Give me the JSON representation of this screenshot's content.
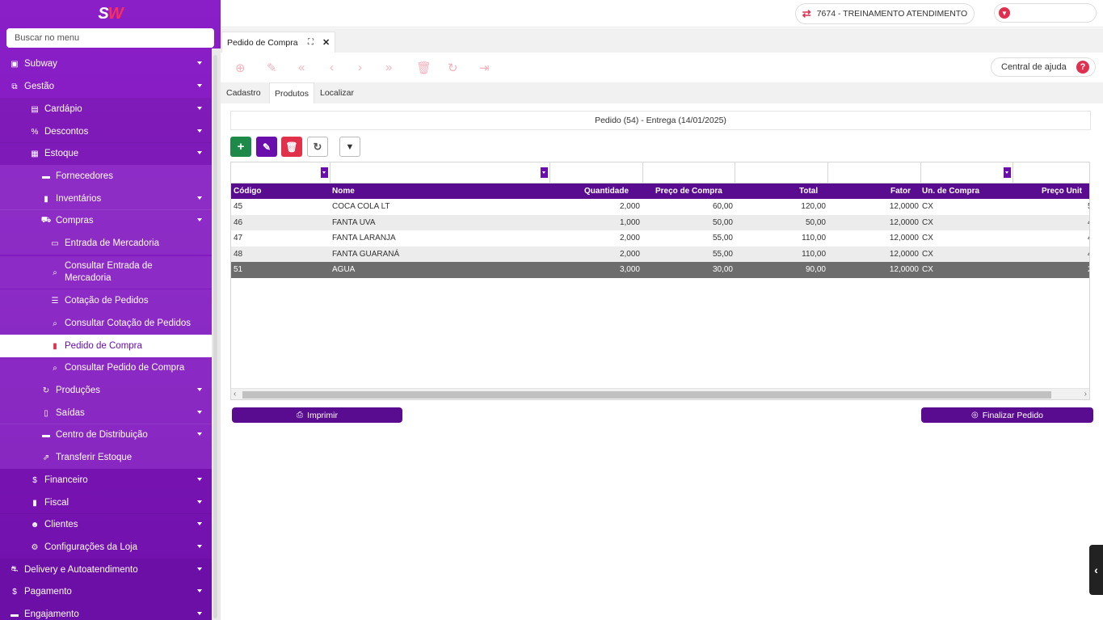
{
  "app": {
    "logo": "SW",
    "logo_accent": "#ff2d55",
    "brand_color": "#7a12b8"
  },
  "sidebar": {
    "search_placeholder": "Buscar no menu",
    "items": [
      {
        "label": "Subway",
        "icon": "store-icon"
      },
      {
        "label": "Gestão",
        "icon": "sitemap-icon"
      },
      {
        "label": "Cardápio",
        "icon": "book-icon"
      },
      {
        "label": "Descontos",
        "icon": "percent-icon"
      },
      {
        "label": "Estoque",
        "icon": "boxes-icon"
      },
      {
        "label": "Fornecedores",
        "icon": "truck-icon"
      },
      {
        "label": "Inventários",
        "icon": "clipboard-icon"
      },
      {
        "label": "Compras",
        "icon": "cart-icon"
      },
      {
        "label": "Entrada de Mercadoria",
        "icon": "box-icon"
      },
      {
        "label": "Consultar Entrada de Mercadoria",
        "icon": "search-icon"
      },
      {
        "label": "Cotação de Pedidos",
        "icon": "list-icon"
      },
      {
        "label": "Consultar Cotação de Pedidos",
        "icon": "search-icon"
      },
      {
        "label": "Pedido de Compra",
        "icon": "file-icon"
      },
      {
        "label": "Consultar Pedido de Compra",
        "icon": "search-icon"
      },
      {
        "label": "Produções",
        "icon": "refresh-icon"
      },
      {
        "label": "Saídas",
        "icon": "door-icon"
      },
      {
        "label": "Centro de Distribuição",
        "icon": "truck-icon"
      },
      {
        "label": "Transferir Estoque",
        "icon": "dolly-icon"
      },
      {
        "label": "Financeiro",
        "icon": "dollar-icon"
      },
      {
        "label": "Fiscal",
        "icon": "file-icon"
      },
      {
        "label": "Clientes",
        "icon": "users-icon"
      },
      {
        "label": "Configurações da Loja",
        "icon": "gear-icon"
      },
      {
        "label": "Delivery e Autoatendimento",
        "icon": "motorcycle-icon"
      },
      {
        "label": "Pagamento",
        "icon": "dollar-icon"
      },
      {
        "label": "Engajamento",
        "icon": "card-icon"
      }
    ]
  },
  "topbar": {
    "store_label": "7674 - TREINAMENTO ATENDIMENTO"
  },
  "tab": {
    "title": "Pedido de Compra"
  },
  "toolbar": {
    "help_label": "Central de ajuda",
    "help_glyph": "?"
  },
  "subtabs": [
    "Cadastro",
    "Produtos",
    "Localizar"
  ],
  "order": {
    "header": "Pedido (54) - Entrega (14/01/2025)"
  },
  "table": {
    "columns": [
      "Código",
      "Nome",
      "Quantidade",
      "Preço de Compra",
      "Total",
      "Fator",
      "Un. de Compra",
      "Preço Unit"
    ],
    "rows": [
      {
        "codigo": "45",
        "nome": "COCA COLA LT",
        "quantidade": "2,000",
        "preco": "60,00",
        "total": "120,00",
        "fator": "12,0000",
        "un": "CX",
        "unit": "5"
      },
      {
        "codigo": "46",
        "nome": "FANTA UVA",
        "quantidade": "1,000",
        "preco": "50,00",
        "total": "50,00",
        "fator": "12,0000",
        "un": "CX",
        "unit": "4"
      },
      {
        "codigo": "47",
        "nome": "FANTA LARANJA",
        "quantidade": "2,000",
        "preco": "55,00",
        "total": "110,00",
        "fator": "12,0000",
        "un": "CX",
        "unit": "4"
      },
      {
        "codigo": "48",
        "nome": "FANTA GUARANÁ",
        "quantidade": "2,000",
        "preco": "55,00",
        "total": "110,00",
        "fator": "12,0000",
        "un": "CX",
        "unit": "4"
      },
      {
        "codigo": "51",
        "nome": "AGUA",
        "quantidade": "3,000",
        "preco": "30,00",
        "total": "90,00",
        "fator": "12,0000",
        "un": "CX",
        "unit": "2"
      }
    ]
  },
  "buttons": {
    "print_label": "Imprimir",
    "finish_label": "Finalizar Pedido"
  }
}
